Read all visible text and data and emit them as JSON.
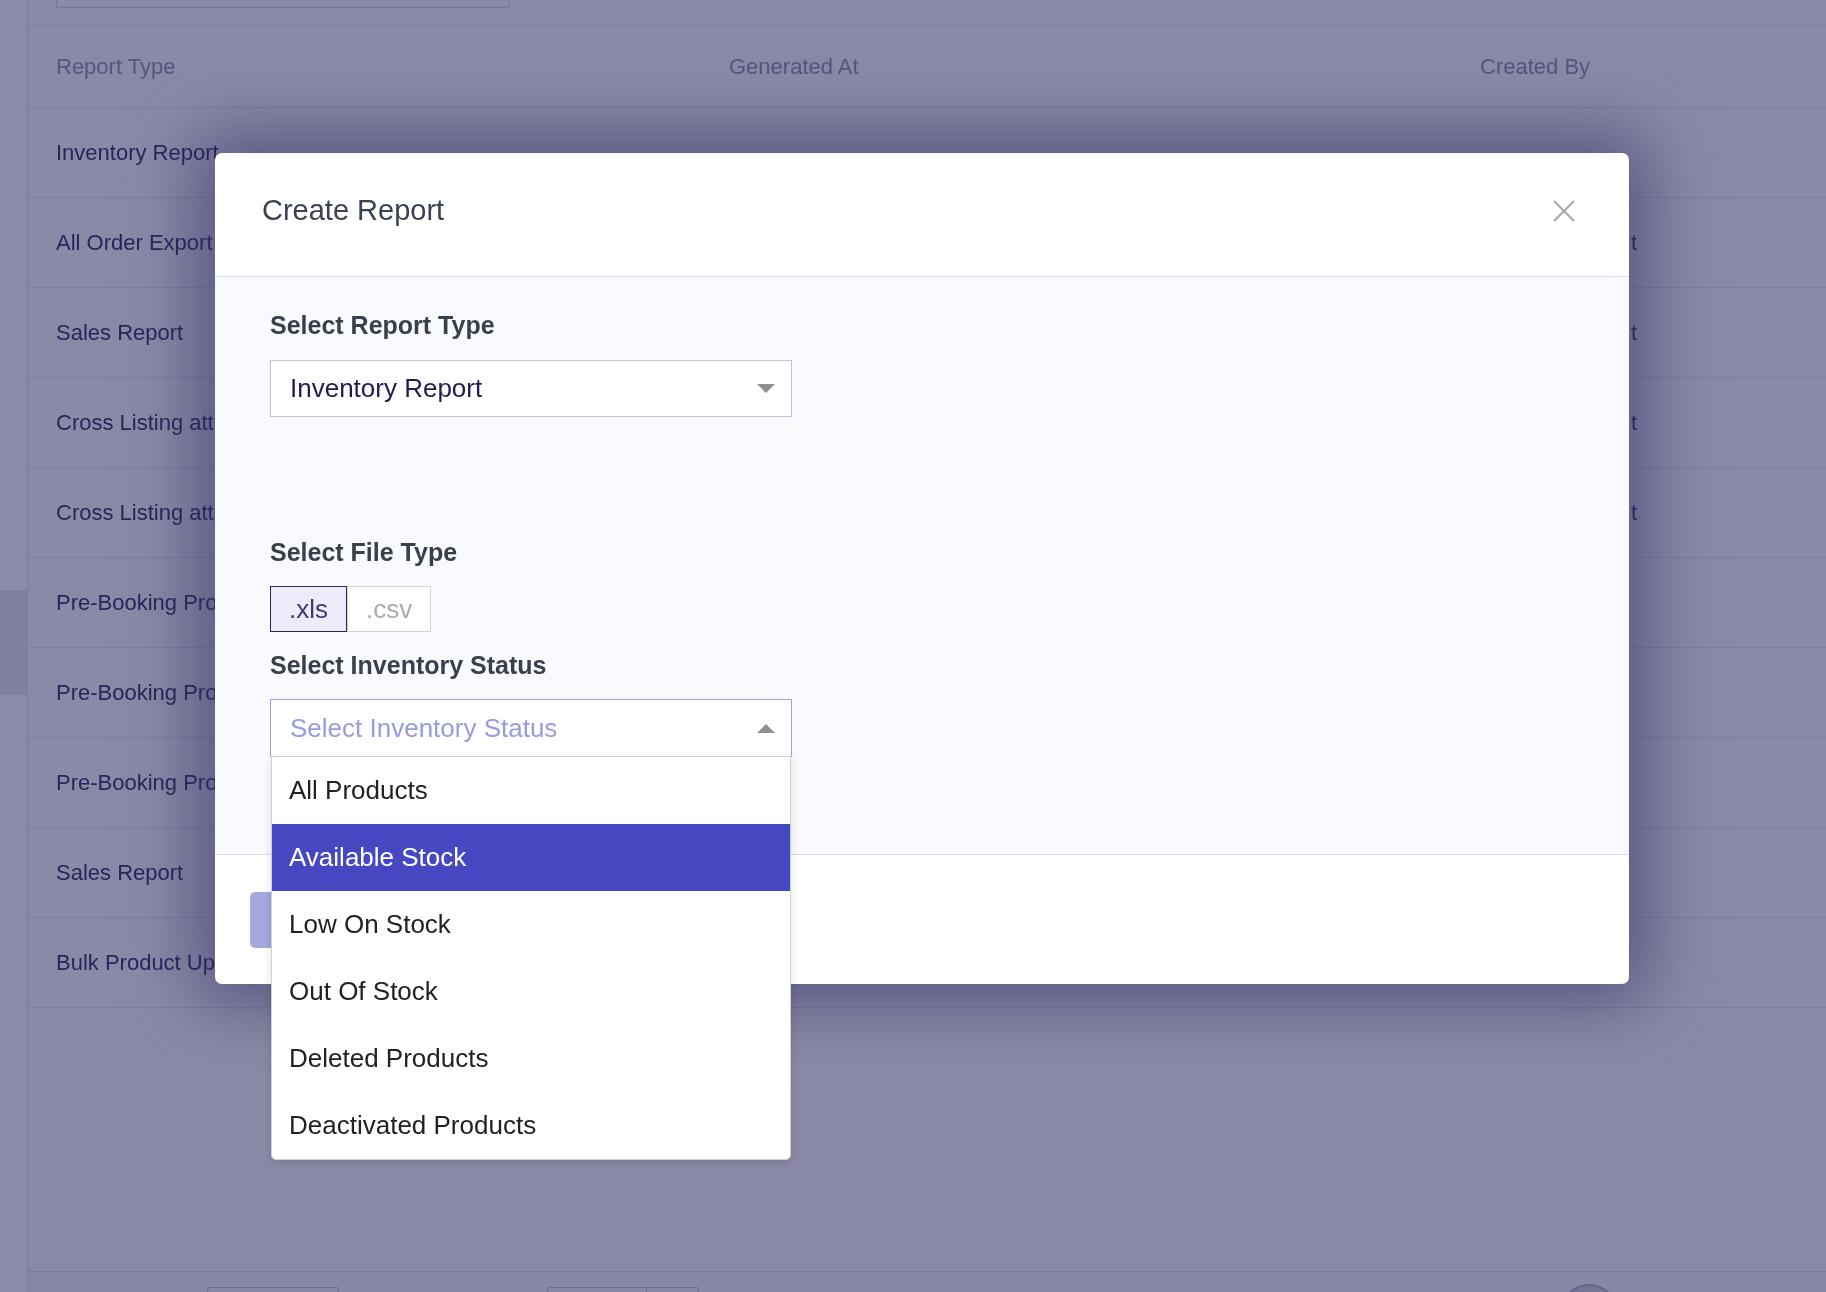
{
  "page": {
    "table": {
      "columns": [
        "Report Type",
        "Generated At",
        "Created By"
      ],
      "rows": [
        {
          "report_type": "Inventory Report"
        },
        {
          "report_type": "All Order Export",
          "created_by": "t"
        },
        {
          "report_type": "Sales Report",
          "created_by": "t"
        },
        {
          "report_type": "Cross Listing att",
          "created_by": "t"
        },
        {
          "report_type": "Cross Listing att",
          "created_by": "t"
        },
        {
          "report_type": "Pre-Booking Pro"
        },
        {
          "report_type": "Pre-Booking Pro"
        },
        {
          "report_type": "Pre-Booking Pro"
        },
        {
          "report_type": "Sales Report"
        },
        {
          "report_type": "Bulk Product Up"
        }
      ]
    }
  },
  "modal": {
    "title": "Create Report",
    "report_type": {
      "label": "Select Report Type",
      "value": "Inventory Report",
      "expanded": false
    },
    "file_type": {
      "label": "Select File Type",
      "options": [
        {
          "label": ".xls",
          "selected": true
        },
        {
          "label": ".csv",
          "selected": false
        }
      ]
    },
    "inventory_status": {
      "label": "Select Inventory Status",
      "placeholder": "Select Inventory Status",
      "expanded": true,
      "options": [
        {
          "label": "All Products",
          "selected": false
        },
        {
          "label": "Available Stock",
          "selected": true
        },
        {
          "label": "Low On Stock",
          "selected": false
        },
        {
          "label": "Out Of Stock",
          "selected": false
        },
        {
          "label": "Deleted Products",
          "selected": false
        },
        {
          "label": "Deactivated Products",
          "selected": false
        }
      ]
    }
  }
}
